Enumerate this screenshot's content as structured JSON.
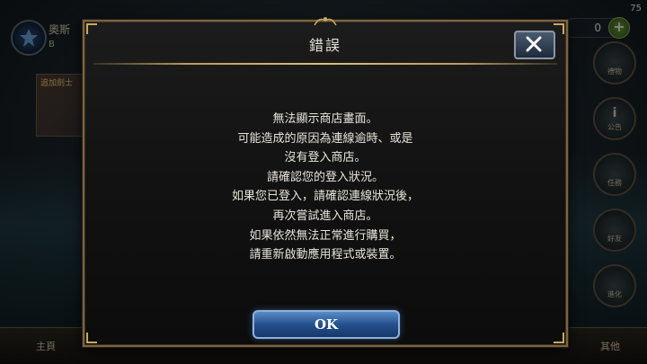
{
  "status_bar": {
    "battery": "75"
  },
  "player": {
    "name": "奧斯",
    "sub": "B"
  },
  "currency": {
    "value": "0",
    "add_label": "+"
  },
  "event_banner": {
    "label": "追加劍士"
  },
  "side_menu": [
    {
      "label": "禮物",
      "icon": "gift-icon",
      "glyph": ""
    },
    {
      "label": "公告",
      "icon": "info-icon",
      "glyph": "i"
    },
    {
      "label": "任務",
      "icon": "quest-icon",
      "glyph": ""
    },
    {
      "label": "好友",
      "icon": "friends-icon",
      "glyph": ""
    },
    {
      "label": "進化",
      "icon": "evolve-icon",
      "glyph": ""
    }
  ],
  "bottom_bar": {
    "left_label": "主頁",
    "right_label": "其他"
  },
  "dialog": {
    "title": "錯誤",
    "message_lines": [
      "無法顯示商店畫面。",
      "可能造成的原因為連線逾時、或是",
      "沒有登入商店。",
      "請確認您的登入狀況。",
      "如果您已登入，請確認連線狀況後，",
      "再次嘗試進入商店。",
      "如果依然無法正常進行購買，",
      "請重新啟動應用程式或裝置。"
    ],
    "ok_label": "OK",
    "close_icon": "close-icon"
  },
  "colors": {
    "dialog_border": "#7a6440",
    "ok_button": "#24508e",
    "text": "#e8e4da"
  }
}
